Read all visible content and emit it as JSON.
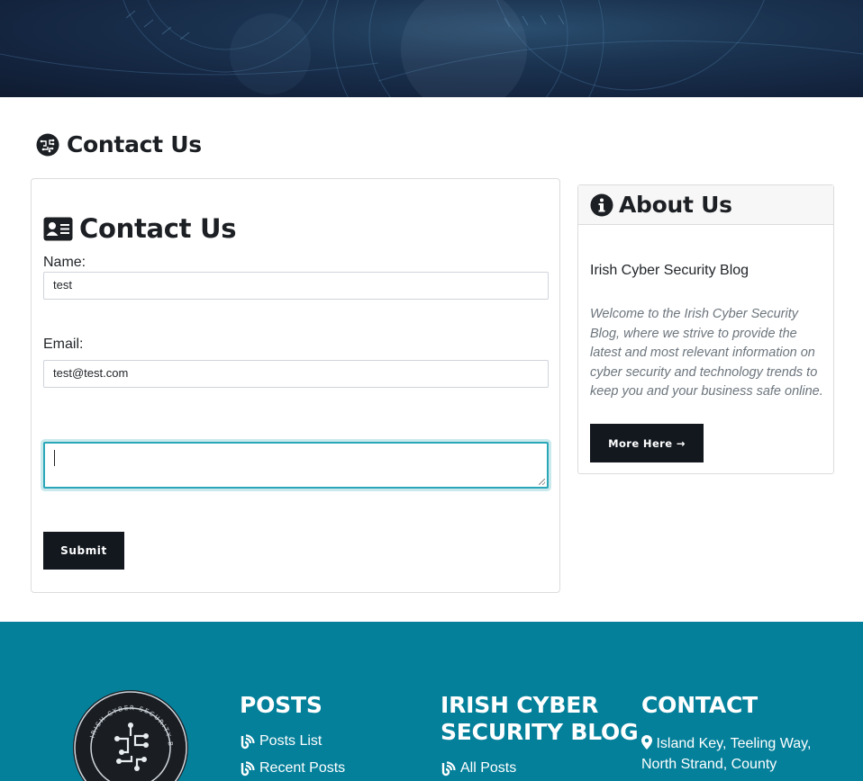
{
  "page": {
    "title": "Contact Us"
  },
  "contact_form": {
    "heading": "Contact Us",
    "name_label": "Name:",
    "name_value": "test",
    "email_label": "Email:",
    "email_value": "test@test.com",
    "message_value": "",
    "submit_label": "Submit"
  },
  "about": {
    "heading": "About Us",
    "subtitle": "Irish Cyber Security Blog",
    "text": "Welcome to the Irish Cyber Security Blog, where we strive to provide the latest and most relevant information on cyber security and technology trends to keep you and your business safe online.",
    "button_label": "More Here →"
  },
  "footer": {
    "logo_text": "IRISH CYBER SECURITY BLOG",
    "posts": {
      "heading": "POSTS",
      "links": [
        "Posts List",
        "Recent Posts"
      ]
    },
    "blog": {
      "heading_line1": "IRISH CYBER",
      "heading_line2": "SECURITY BLOG",
      "links": [
        "All Posts"
      ]
    },
    "contact": {
      "heading": "CONTACT",
      "address_line1": "Island Key, Teeling Way,",
      "address_line2": "North Strand, County"
    }
  },
  "colors": {
    "accent": "#05809b",
    "button": "#13181f",
    "focus": "#2aa7b8"
  },
  "icons": {
    "page_title": "brain-circuit-icon",
    "contact_heading": "address-card-icon",
    "about_heading": "info-circle-icon",
    "footer_links": "blog-rss-icon",
    "address": "map-marker-icon"
  }
}
